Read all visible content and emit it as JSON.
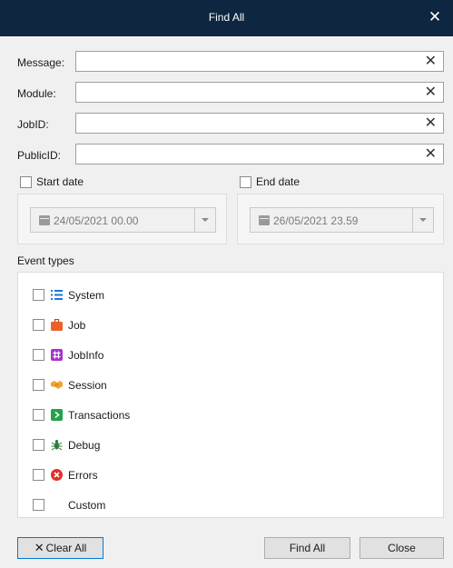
{
  "window": {
    "title": "Find All",
    "close_glyph": "✕"
  },
  "fields": [
    {
      "label": "Message:",
      "value": "",
      "clear_glyph": "✕"
    },
    {
      "label": "Module:",
      "value": "",
      "clear_glyph": "✕"
    },
    {
      "label": "JobID:",
      "value": "",
      "clear_glyph": "✕"
    },
    {
      "label": "PublicID:",
      "value": "",
      "clear_glyph": "✕"
    }
  ],
  "start_date": {
    "label": "Start date",
    "checked": false,
    "value": "24/05/2021 00.00",
    "enabled": false
  },
  "end_date": {
    "label": "End date",
    "checked": false,
    "value": "26/05/2021 23.59",
    "enabled": false
  },
  "event_types": {
    "label": "Event types",
    "items": [
      {
        "label": "System",
        "icon": "list-icon",
        "color": "#1e73d9",
        "checked": false
      },
      {
        "label": "Job",
        "icon": "briefcase-icon",
        "color": "#e8622a",
        "checked": false
      },
      {
        "label": "JobInfo",
        "icon": "hash-icon",
        "color": "#a435c8",
        "checked": false
      },
      {
        "label": "Session",
        "icon": "handshake-icon",
        "color": "#f2a531",
        "checked": false
      },
      {
        "label": "Transactions",
        "icon": "arrow-right-icon",
        "color": "#22a447",
        "checked": false
      },
      {
        "label": "Debug",
        "icon": "bug-icon",
        "color": "#2b7a3b",
        "checked": false
      },
      {
        "label": "Errors",
        "icon": "error-icon",
        "color": "#e0312b",
        "checked": false
      },
      {
        "label": "Custom",
        "icon": "none",
        "checked": false
      }
    ]
  },
  "buttons": {
    "clear_all": "Clear All",
    "find_all": "Find All",
    "close": "Close"
  }
}
